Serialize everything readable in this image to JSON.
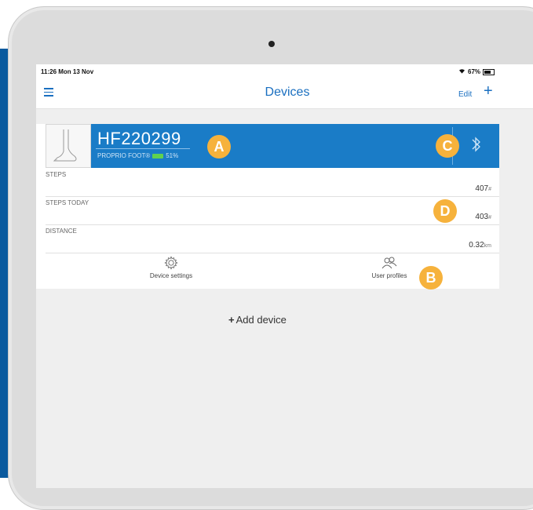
{
  "status": {
    "time": "11:26  Mon 13 Nov",
    "battery": "67%"
  },
  "nav": {
    "title": "Devices",
    "edit_label": "Edit",
    "add_icon": "plus-icon",
    "menu_icon": "hamburger-icon"
  },
  "device": {
    "name": "HF220299",
    "model": "PROPRIO FOOT®",
    "battery": "51%",
    "bluetooth_icon": "bluetooth-icon"
  },
  "metrics": [
    {
      "label": "STEPS",
      "value": "407",
      "unit": "#"
    },
    {
      "label": "STEPS TODAY",
      "value": "403",
      "unit": "#"
    },
    {
      "label": "DISTANCE",
      "value": "0.32",
      "unit": "km"
    }
  ],
  "actions": {
    "settings_label": "Device settings",
    "profiles_label": "User profiles"
  },
  "add_device_label": "Add device",
  "badges": {
    "a": "A",
    "b": "B",
    "c": "C",
    "d": "D"
  },
  "colors": {
    "brand_blue": "#1a7cc7",
    "badge_orange": "#f6b23c",
    "battery_green": "#5fd14f"
  }
}
